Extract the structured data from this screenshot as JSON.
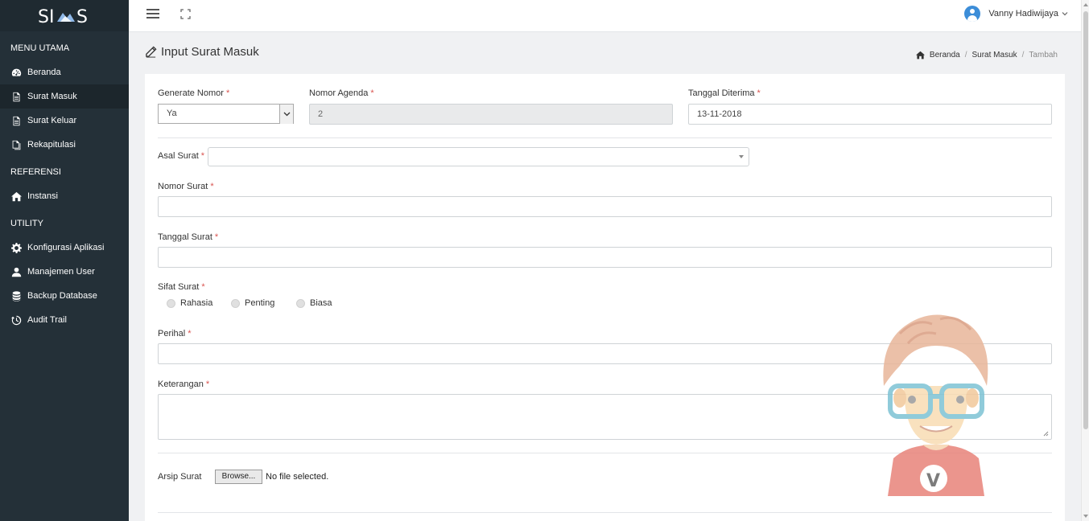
{
  "app": {
    "logo": "SIAS"
  },
  "sidebar": {
    "sections": [
      {
        "title": "MENU UTAMA",
        "items": [
          {
            "label": "Beranda",
            "icon": "dashboard-icon"
          },
          {
            "label": "Surat Masuk",
            "icon": "document-icon",
            "active": true
          },
          {
            "label": "Surat Keluar",
            "icon": "document-icon"
          },
          {
            "label": "Rekapitulasi",
            "icon": "copy-icon"
          }
        ]
      },
      {
        "title": "REFERENSI",
        "items": [
          {
            "label": "Instansi",
            "icon": "home-icon"
          }
        ]
      },
      {
        "title": "UTILITY",
        "items": [
          {
            "label": "Konfigurasi Aplikasi",
            "icon": "gear-icon"
          },
          {
            "label": "Manajemen User",
            "icon": "user-icon"
          },
          {
            "label": "Backup Database",
            "icon": "database-icon"
          },
          {
            "label": "Audit Trail",
            "icon": "history-icon"
          }
        ]
      }
    ]
  },
  "topbar": {
    "user_name": "Vanny Hadiwijaya"
  },
  "page": {
    "title": "Input Surat Masuk",
    "breadcrumb": [
      "Beranda",
      "Surat Masuk",
      "Tambah"
    ]
  },
  "form": {
    "generate_nomor": {
      "label": "Generate Nomor",
      "value": "Ya"
    },
    "nomor_agenda": {
      "label": "Nomor Agenda",
      "value": "2"
    },
    "tanggal_diterima": {
      "label": "Tanggal Diterima",
      "value": "13-11-2018"
    },
    "asal_surat": {
      "label": "Asal Surat",
      "value": ""
    },
    "nomor_surat": {
      "label": "Nomor Surat",
      "value": ""
    },
    "tanggal_surat": {
      "label": "Tanggal Surat",
      "value": ""
    },
    "sifat_surat": {
      "label": "Sifat Surat",
      "options": [
        "Rahasia",
        "Penting",
        "Biasa"
      ]
    },
    "perihal": {
      "label": "Perihal",
      "value": ""
    },
    "keterangan": {
      "label": "Keterangan",
      "value": ""
    },
    "arsip_surat": {
      "label": "Arsip Surat",
      "browse_label": "Browse...",
      "status": "No file selected."
    },
    "required_mark": "*"
  },
  "colors": {
    "sidebar_bg": "#243038",
    "accent": "#3c8dd8",
    "required": "#d9534f"
  }
}
